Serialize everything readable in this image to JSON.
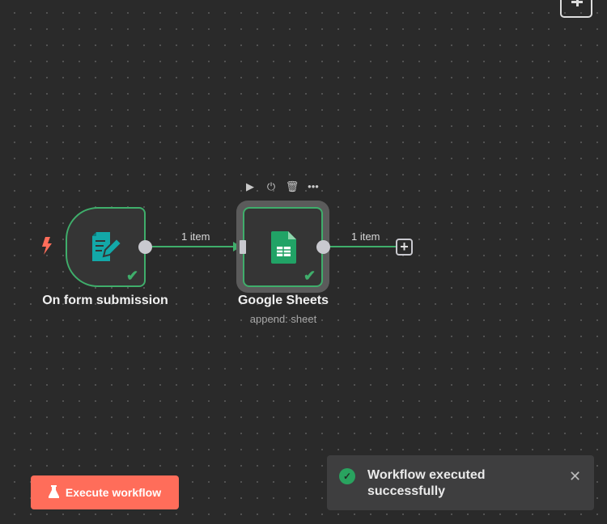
{
  "canvas": {
    "add_node_icon": "plus-icon"
  },
  "nodes": [
    {
      "name": "On form submission",
      "icon": "form-edit-icon",
      "status": "success",
      "trigger_icon": "lightning-icon"
    },
    {
      "name": "Google Sheets",
      "subtitle": "append: sheet",
      "icon": "google-sheets-icon",
      "status": "success"
    }
  ],
  "edges": [
    {
      "label": "1 item"
    },
    {
      "label": "1 item"
    }
  ],
  "node_toolbar": [
    "play-icon",
    "power-icon",
    "trash-icon",
    "more-icon"
  ],
  "execute_button": {
    "label": "Execute workflow",
    "color": "#ff6d5a"
  },
  "toast": {
    "message": "Workflow executed successfully",
    "status_color": "#29a35f"
  },
  "colors": {
    "success": "#3fae6b",
    "form_icon": "#13a8a8",
    "sheets_icon": "#21a366"
  }
}
